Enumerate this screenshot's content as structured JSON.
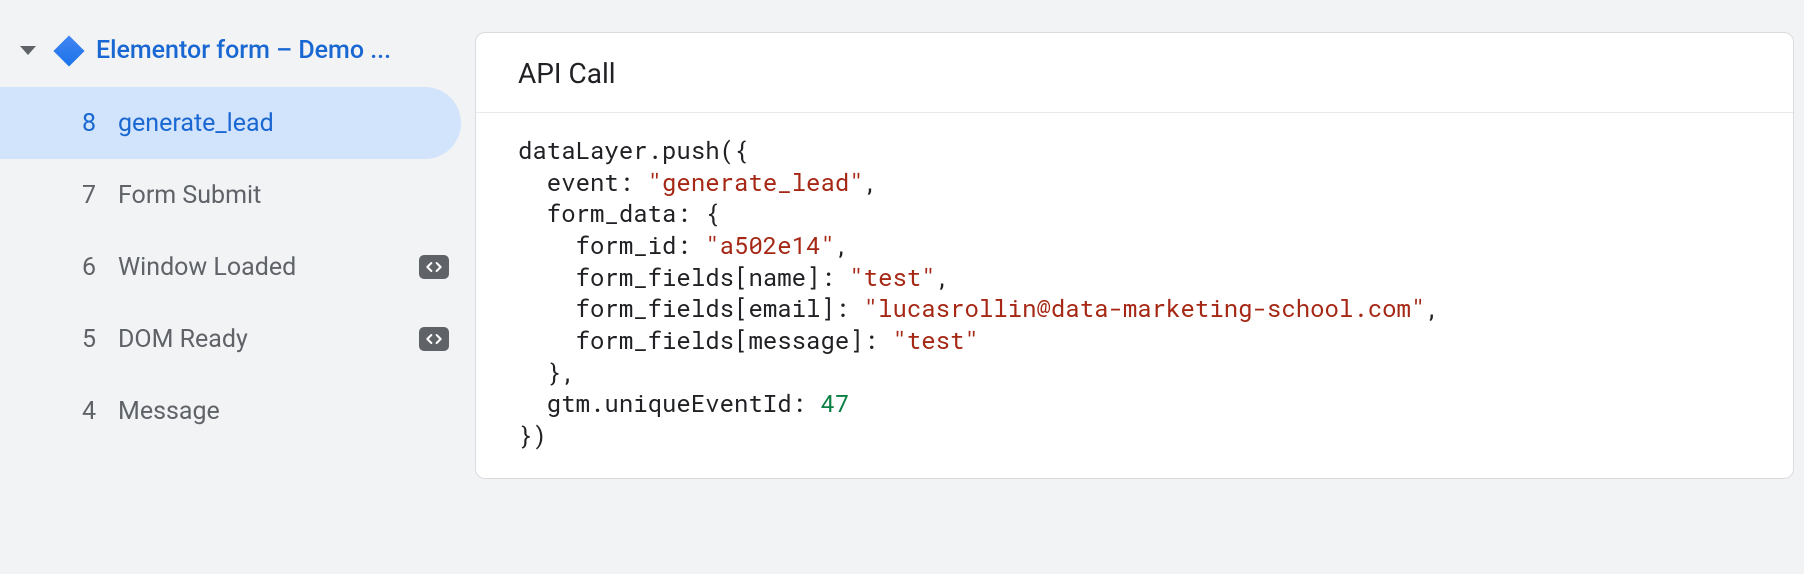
{
  "sidebar": {
    "tag_name": "Elementor form – Demo ...",
    "events": [
      {
        "num": "8",
        "label": "generate_lead",
        "selected": true,
        "code": false
      },
      {
        "num": "7",
        "label": "Form Submit",
        "selected": false,
        "code": false
      },
      {
        "num": "6",
        "label": "Window Loaded",
        "selected": false,
        "code": true
      },
      {
        "num": "5",
        "label": "DOM Ready",
        "selected": false,
        "code": true
      },
      {
        "num": "4",
        "label": "Message",
        "selected": false,
        "code": false
      }
    ]
  },
  "main": {
    "card_title": "API Call",
    "code": {
      "l1a": "dataLayer.push({",
      "l2a": "  event: ",
      "l2s": "\"generate_lead\"",
      "l2b": ",",
      "l3a": "  form_data: {",
      "l4a": "    form_id: ",
      "l4s": "\"a502e14\"",
      "l4b": ",",
      "l5a": "    form_fields[name]: ",
      "l5s": "\"test\"",
      "l5b": ",",
      "l6a": "    form_fields[email]: ",
      "l6s": "\"lucasrollin@data-marketing-school.com\"",
      "l6b": ",",
      "l7a": "    form_fields[message]: ",
      "l7s": "\"test\"",
      "l8a": "  },",
      "l9a": "  gtm.uniqueEventId: ",
      "l9n": "47",
      "l10a": "})"
    }
  }
}
